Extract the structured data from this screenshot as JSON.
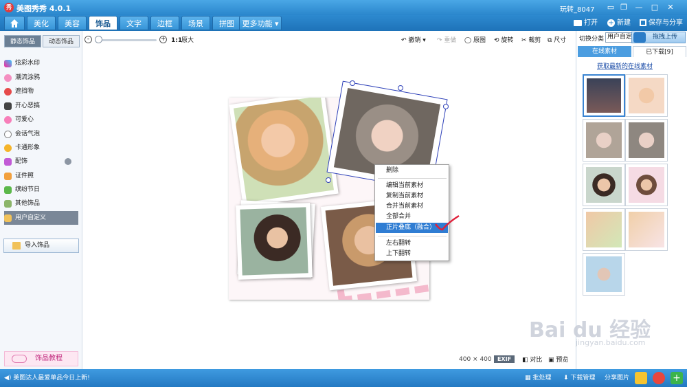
{
  "app": {
    "title": "美图秀秀 4.0.1",
    "logo_text": "秀",
    "user": "玩转_8047"
  },
  "window": {
    "controls": [
      "▭",
      "❐",
      "—",
      "□",
      "✕"
    ]
  },
  "tabs": [
    {
      "label": "",
      "icon": "home-icon"
    },
    {
      "label": "美化"
    },
    {
      "label": "美容"
    },
    {
      "label": "饰品",
      "active": true
    },
    {
      "label": "文字"
    },
    {
      "label": "边框"
    },
    {
      "label": "场景"
    },
    {
      "label": "拼图"
    },
    {
      "label": "更多功能 ▾"
    }
  ],
  "header_actions": {
    "open": "打开",
    "new": "新建",
    "save_share": "保存与分享"
  },
  "left": {
    "subtabs": [
      "静态饰品",
      "动态饰品"
    ],
    "categories": [
      "炫彩水印",
      "潮流涂鸦",
      "遮挡物",
      "开心恶搞",
      "可爱心",
      "会话气泡",
      "卡通形象",
      "配饰",
      "证件照",
      "缤纷节日",
      "其他饰品",
      "用户自定义"
    ],
    "import_label": "导入饰品",
    "tutorial_label": "饰品教程"
  },
  "editor_toolbar": {
    "zoom_actual": "1:1",
    "zoom_original": "原大",
    "undo": "撤销",
    "redo": "重做",
    "original": "原图",
    "rotate": "旋转",
    "crop": "裁剪",
    "size": "尺寸"
  },
  "context_menu": {
    "items": [
      "删除",
      "编辑当前素材",
      "复制当前素材",
      "合并当前素材",
      "全部合并",
      "正片叠底（融合）",
      "左右翻转",
      "上下翻转"
    ],
    "highlighted": "正片叠底（融合）"
  },
  "bottom_info": {
    "size": "400 × 400",
    "exif": "EXIF",
    "compare": "对比",
    "preview": "预览"
  },
  "right": {
    "category_switch_label": "切换分类",
    "category_select": "用户自定",
    "drag_upload": "拖拽上传",
    "tabs": [
      "在线素材",
      "已下载[9]"
    ],
    "fetch_link": "获取最新的在线素材"
  },
  "status": {
    "message": "美图达人最爱单品今日上新!",
    "batch": "批处理",
    "download_manager": "下载管理",
    "share_pic": "分享图片"
  },
  "watermark": {
    "brand": "Bai du 经验",
    "url": "jingyan.baidu.com"
  }
}
